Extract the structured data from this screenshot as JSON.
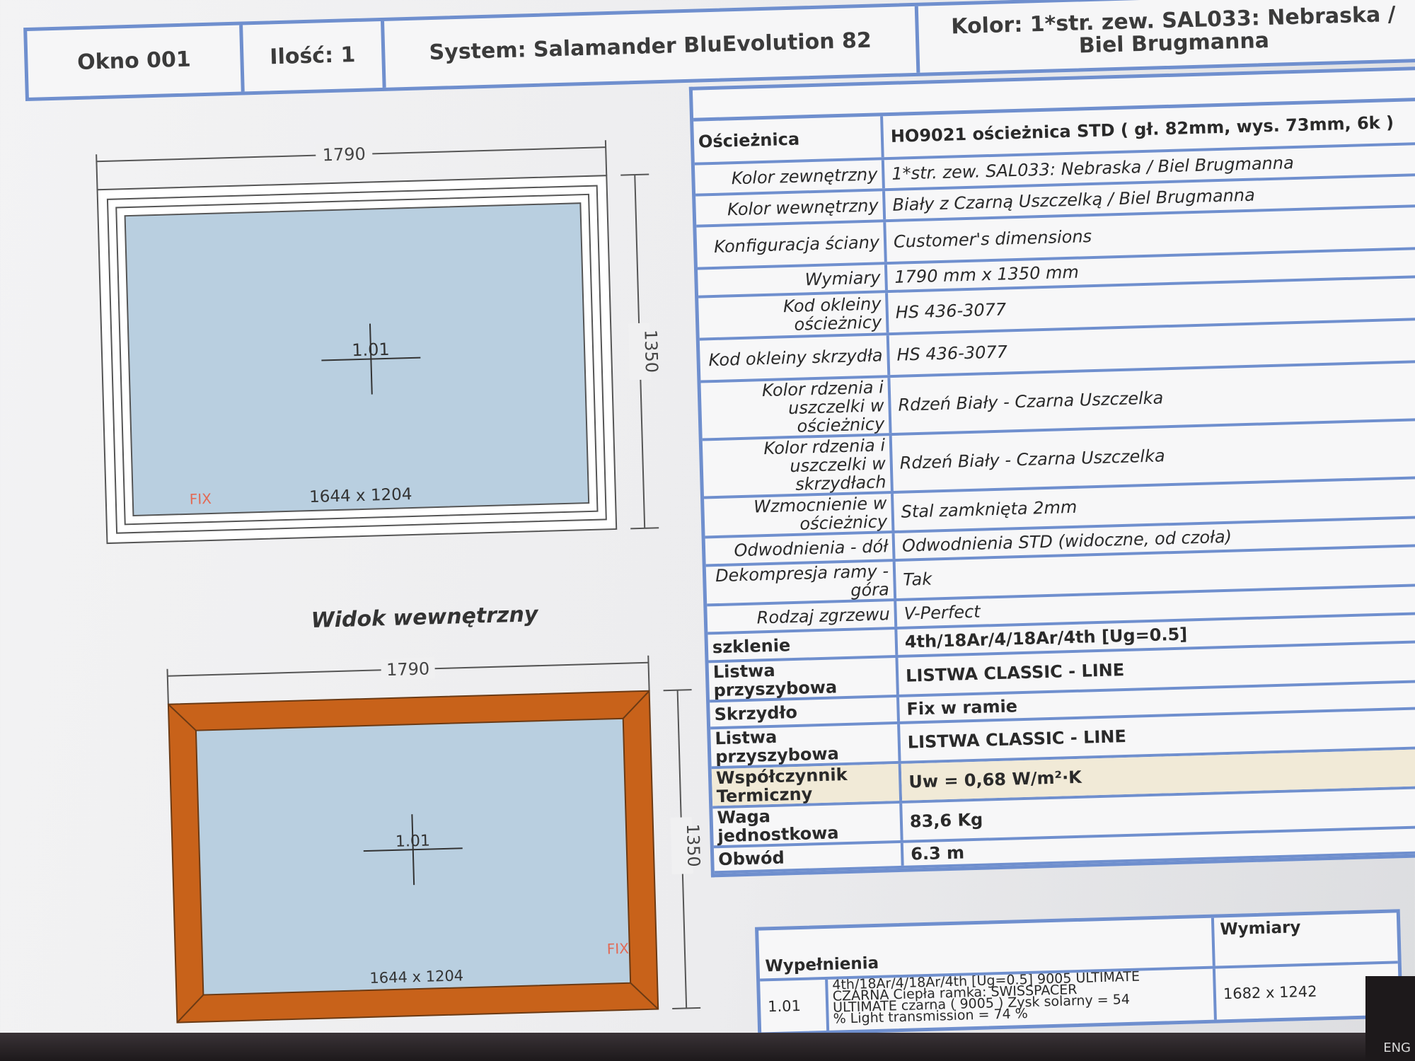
{
  "header": {
    "window_name": "Okno 001",
    "quantity": "Ilość: 1",
    "system": "System: Salamander BluEvolution 82",
    "color": "Kolor: 1*str. zew. SAL033: Nebraska / Biel Brugmanna"
  },
  "drawings": {
    "outside": {
      "width_label": "1790",
      "height_label": "1350",
      "field_label": "1.01",
      "glass_size": "1644 x 1204",
      "type_label": "FIX"
    },
    "inside_title": "Widok wewnętrzny",
    "inside": {
      "width_label": "1790",
      "height_label": "1350",
      "field_label": "1.01",
      "glass_size": "1644 x 1204",
      "type_label": "FIX"
    },
    "colors": {
      "glass": "#b9cfe0",
      "frame_outside": "#ffffff",
      "frame_inside": "#c8621a"
    }
  },
  "spec": [
    {
      "label": "Ościeżnica",
      "value": "HO9021 ościeżnica STD ( gł. 82mm, wys. 73mm, 6k )",
      "style": "bold"
    },
    {
      "label": "Kolor zewnętrzny",
      "value": "1*str. zew. SAL033: Nebraska / Biel Brugmanna"
    },
    {
      "label": "Kolor wewnętrzny",
      "value": "Biały z Czarną Uszczelką / Biel Brugmanna"
    },
    {
      "label": "Konfiguracja ściany",
      "value": "Customer's dimensions"
    },
    {
      "label": "Wymiary",
      "value": "1790 mm x 1350 mm"
    },
    {
      "label": "Kod okleiny ościeżnicy",
      "value": "HS 436-3077"
    },
    {
      "label": "Kod okleiny skrzydła",
      "value": "HS 436-3077"
    },
    {
      "label": "Kolor rdzenia i uszczelki w ościeżnicy",
      "value": "Rdzeń Biały - Czarna Uszczelka"
    },
    {
      "label": "Kolor rdzenia i uszczelki w skrzydłach",
      "value": "Rdzeń Biały - Czarna Uszczelka"
    },
    {
      "label": "Wzmocnienie w ościeżnicy",
      "value": "Stal zamknięta 2mm"
    },
    {
      "label": "Odwodnienia - dół",
      "value": "Odwodnienia STD (widoczne, od czoła)"
    },
    {
      "label": "Dekompresja ramy - góra",
      "value": "Tak"
    },
    {
      "label": "Rodzaj zgrzewu",
      "value": "V-Perfect"
    },
    {
      "label": "szklenie",
      "value": "4th/18Ar/4/18Ar/4th [Ug=0.5]",
      "style": "bold"
    },
    {
      "label": "Listwa przyszybowa",
      "value": "LISTWA CLASSIC - LINE",
      "style": "bold"
    },
    {
      "label": "Skrzydło",
      "value": "Fix w ramie",
      "style": "bold"
    },
    {
      "label": "Listwa przyszybowa",
      "value": "LISTWA CLASSIC - LINE",
      "style": "bold"
    },
    {
      "label": "Współczynnik Termiczny",
      "value": "Uw = 0,68 W/m²·K",
      "style": "bold",
      "highlight": true
    },
    {
      "label": "Waga jednostkowa",
      "value": "83,6 Kg",
      "style": "bold"
    },
    {
      "label": "Obwód",
      "value": "6.3 m",
      "style": "bold"
    }
  ],
  "fill_table": {
    "header_left": "Wypełnienia",
    "header_right": "Wymiary",
    "row": {
      "id": "1.01",
      "desc": [
        "4th/18Ar/4/18Ar/4th [Ug=0.5] 9005 ULTIMATE",
        "CZARNA Ciepła ramka: SWISSPACER",
        "ULTIMATE czarna ( 9005 ) Zysk solarny = 54",
        "% Light transmission = 74 %"
      ],
      "dims": "1682 x 1242"
    }
  },
  "taskbar": {
    "lang": "ENG"
  }
}
